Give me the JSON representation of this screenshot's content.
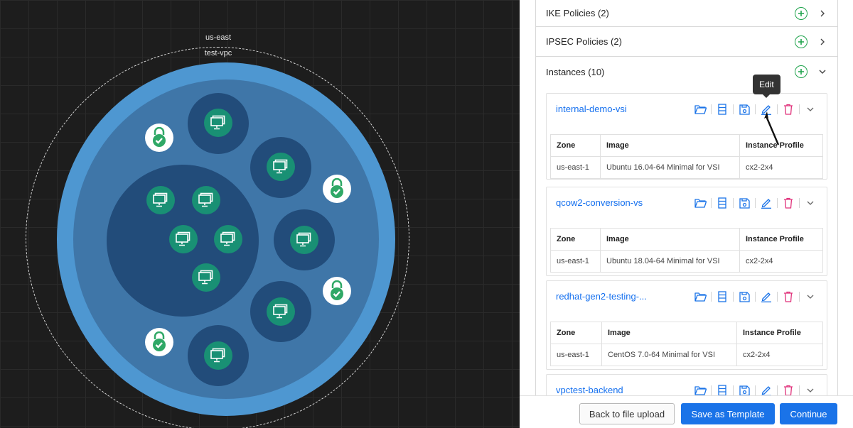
{
  "diagram": {
    "region_label": "us-east",
    "vpc_label": "test-vpc"
  },
  "sections": [
    {
      "title": "IKE Policies (2)",
      "expanded": false
    },
    {
      "title": "IPSEC Policies (2)",
      "expanded": false
    },
    {
      "title": "Instances (10)",
      "expanded": true
    }
  ],
  "instances": {
    "columns": [
      "Zone",
      "Image",
      "Instance Profile"
    ],
    "items": [
      {
        "name": "internal-demo-vsi",
        "zone": "us-east-1",
        "image": "Ubuntu 16.04-64 Minimal for VSI",
        "profile": "cx2-2x4"
      },
      {
        "name": "qcow2-conversion-vs",
        "zone": "us-east-1",
        "image": "Ubuntu 18.04-64 Minimal for VSI",
        "profile": "cx2-2x4"
      },
      {
        "name": "redhat-gen2-testing-...",
        "zone": "us-east-1",
        "image": "CentOS 7.0-64 Minimal for VSI",
        "profile": "cx2-2x4"
      },
      {
        "name": "vpctest-backend"
      }
    ]
  },
  "tooltip": {
    "text": "Edit"
  },
  "footer": {
    "back_label": "Back to file upload",
    "save_template_label": "Save as Template",
    "continue_label": "Continue"
  },
  "colors": {
    "accent": "#1a73e8",
    "link": "#1570ef",
    "add": "#1fa44c",
    "delete": "#e0307a",
    "vsi_green": "#199074",
    "subnet_blue": "#224c7a"
  },
  "icons": [
    "folder-icon",
    "storage-icon",
    "save-icon",
    "edit-icon",
    "trash-icon",
    "chevron-down-icon",
    "chevron-right-icon",
    "plus-circle-icon",
    "monitor-icon",
    "lock-check-icon"
  ]
}
